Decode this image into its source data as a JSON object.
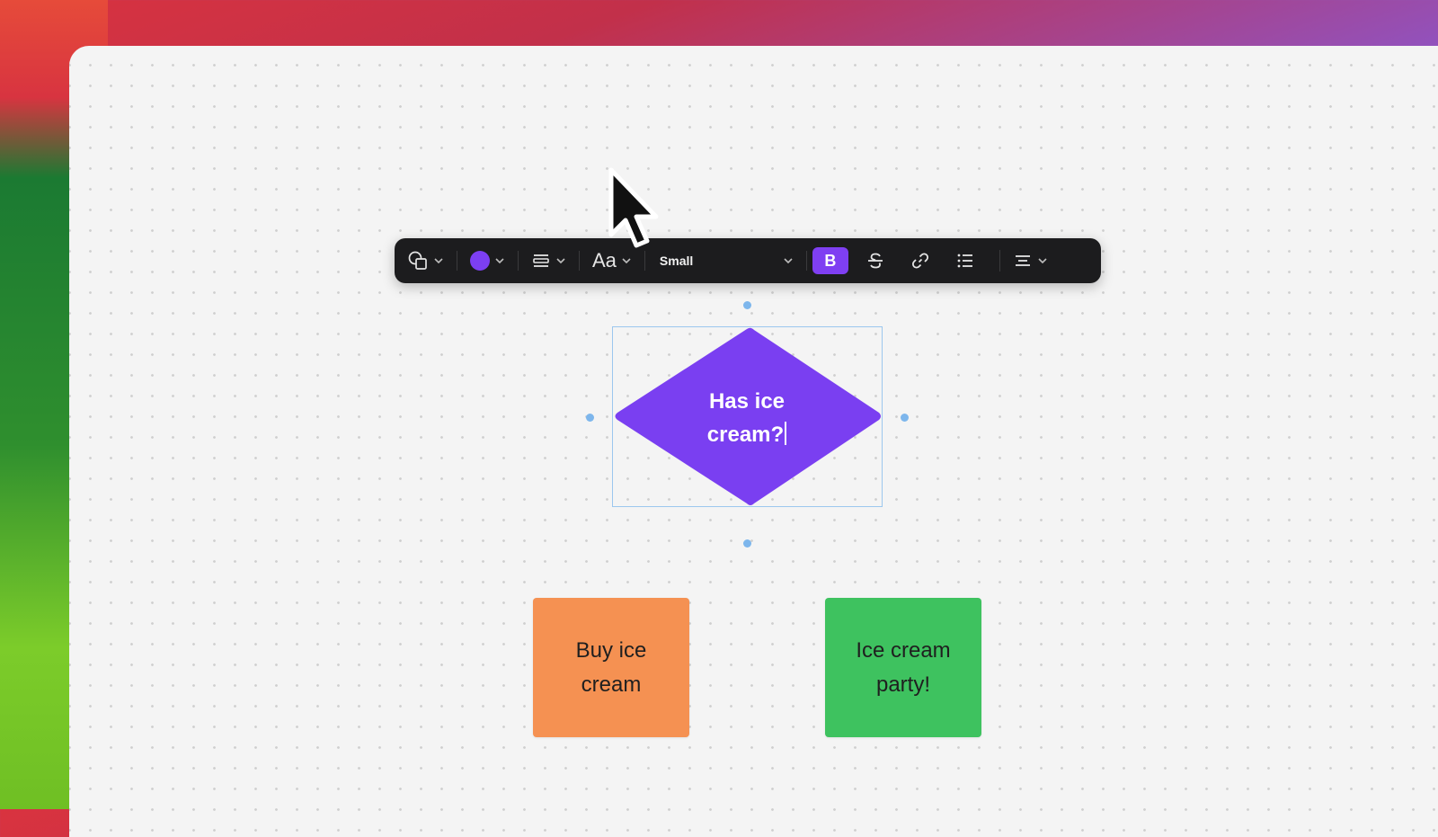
{
  "toolbar": {
    "shape_icon": "shapes-icon",
    "fill_color": "#7c3ff2",
    "line_style_icon": "line-style-icon",
    "font_icon_label": "Aa",
    "font_size": "Small",
    "bold_label": "B",
    "bold_active": true,
    "strikethrough_icon": "strikethrough-icon",
    "link_icon": "link-icon",
    "list_icon": "bulleted-list-icon",
    "align_icon": "align-center-icon"
  },
  "canvas": {
    "decision": {
      "line1": "Has ice",
      "line2": "cream?",
      "color": "#7a3ff1"
    },
    "boxes": [
      {
        "line1": "Buy ice",
        "line2": "cream",
        "color": "#f59152"
      },
      {
        "line1": "Ice cream",
        "line2": "party!",
        "color": "#3ec25f"
      }
    ]
  }
}
